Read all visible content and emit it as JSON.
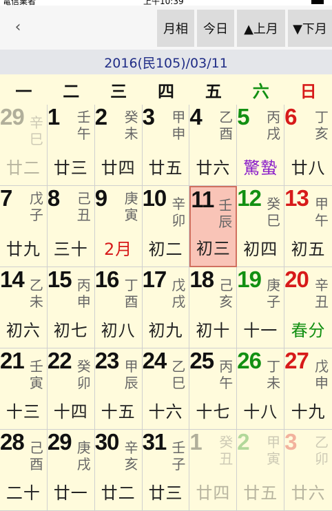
{
  "status_bar": {
    "carrier": "電信業者",
    "time": "上午10:39"
  },
  "toolbar": {
    "back_icon": "chevron-left-icon",
    "buttons": [
      "月相",
      "今日",
      "▲上月",
      "▼下月"
    ]
  },
  "date_display": "2016(民105)/03/11",
  "weekdays": [
    "一",
    "二",
    "三",
    "四",
    "五",
    "六",
    "日"
  ],
  "colors": {
    "weekend_sat": "#129012",
    "weekend_sun": "#d71a1a",
    "solar_term": "#8b20c9",
    "today_bg": "#f9c4b7"
  },
  "weeks": [
    [
      {
        "day": "29",
        "gz1": "辛",
        "gz2": "巳",
        "lunar": "廿二",
        "faded": true
      },
      {
        "day": "1",
        "gz1": "壬",
        "gz2": "午",
        "lunar": "廿三"
      },
      {
        "day": "2",
        "gz1": "癸",
        "gz2": "未",
        "lunar": "廿四"
      },
      {
        "day": "3",
        "gz1": "甲",
        "gz2": "申",
        "lunar": "廿五"
      },
      {
        "day": "4",
        "gz1": "乙",
        "gz2": "酉",
        "lunar": "廿六"
      },
      {
        "day": "5",
        "gz1": "丙",
        "gz2": "戌",
        "lunar": "驚蟄",
        "lunar_color": "purple"
      },
      {
        "day": "6",
        "gz1": "丁",
        "gz2": "亥",
        "lunar": "廿八"
      }
    ],
    [
      {
        "day": "7",
        "gz1": "戊",
        "gz2": "子",
        "lunar": "廿九"
      },
      {
        "day": "8",
        "gz1": "己",
        "gz2": "丑",
        "lunar": "三十"
      },
      {
        "day": "9",
        "gz1": "庚",
        "gz2": "寅",
        "lunar": "2月",
        "lunar_color": "red"
      },
      {
        "day": "10",
        "gz1": "辛",
        "gz2": "卯",
        "lunar": "初二"
      },
      {
        "day": "11",
        "gz1": "壬",
        "gz2": "辰",
        "lunar": "初三",
        "today": true
      },
      {
        "day": "12",
        "gz1": "癸",
        "gz2": "巳",
        "lunar": "初四"
      },
      {
        "day": "13",
        "gz1": "甲",
        "gz2": "午",
        "lunar": "初五"
      }
    ],
    [
      {
        "day": "14",
        "gz1": "乙",
        "gz2": "未",
        "lunar": "初六"
      },
      {
        "day": "15",
        "gz1": "丙",
        "gz2": "申",
        "lunar": "初七"
      },
      {
        "day": "16",
        "gz1": "丁",
        "gz2": "酉",
        "lunar": "初八"
      },
      {
        "day": "17",
        "gz1": "戊",
        "gz2": "戌",
        "lunar": "初九"
      },
      {
        "day": "18",
        "gz1": "己",
        "gz2": "亥",
        "lunar": "初十"
      },
      {
        "day": "19",
        "gz1": "庚",
        "gz2": "子",
        "lunar": "十一"
      },
      {
        "day": "20",
        "gz1": "辛",
        "gz2": "丑",
        "lunar": "春分",
        "lunar_color": "green"
      }
    ],
    [
      {
        "day": "21",
        "gz1": "壬",
        "gz2": "寅",
        "lunar": "十三"
      },
      {
        "day": "22",
        "gz1": "癸",
        "gz2": "卯",
        "lunar": "十四"
      },
      {
        "day": "23",
        "gz1": "甲",
        "gz2": "辰",
        "lunar": "十五"
      },
      {
        "day": "24",
        "gz1": "乙",
        "gz2": "巳",
        "lunar": "十六"
      },
      {
        "day": "25",
        "gz1": "丙",
        "gz2": "午",
        "lunar": "十七"
      },
      {
        "day": "26",
        "gz1": "丁",
        "gz2": "未",
        "lunar": "十八"
      },
      {
        "day": "27",
        "gz1": "戊",
        "gz2": "申",
        "lunar": "十九"
      }
    ],
    [
      {
        "day": "28",
        "gz1": "己",
        "gz2": "酉",
        "lunar": "二十"
      },
      {
        "day": "29",
        "gz1": "庚",
        "gz2": "戌",
        "lunar": "廿一"
      },
      {
        "day": "30",
        "gz1": "辛",
        "gz2": "亥",
        "lunar": "廿二"
      },
      {
        "day": "31",
        "gz1": "壬",
        "gz2": "子",
        "lunar": "廿三"
      },
      {
        "day": "1",
        "gz1": "癸",
        "gz2": "丑",
        "lunar": "廿四",
        "faded": true
      },
      {
        "day": "2",
        "gz1": "甲",
        "gz2": "寅",
        "lunar": "廿五",
        "faded": true
      },
      {
        "day": "3",
        "gz1": "乙",
        "gz2": "卯",
        "lunar": "廿六",
        "faded": true
      }
    ]
  ]
}
